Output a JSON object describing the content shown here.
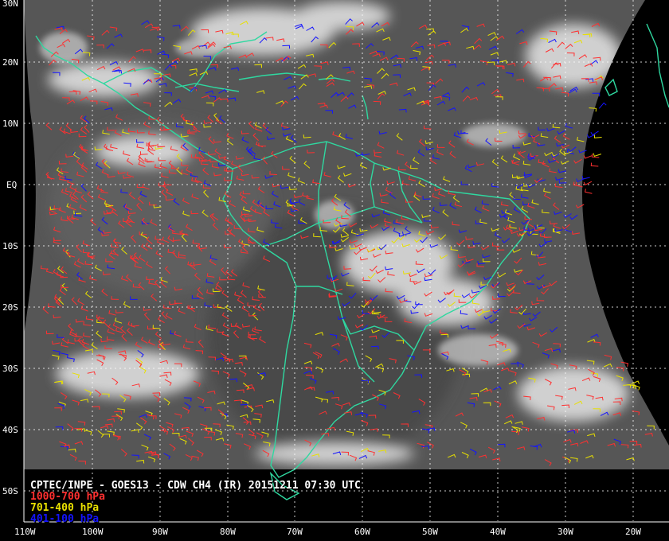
{
  "title": "CPTEC/INPE - GOES13 - CDW CH4 (IR) 20151211 07:30 UTC",
  "legend": [
    {
      "label": "1000-700 hPa",
      "color": "#ff3030"
    },
    {
      "label": "701-400 hPa",
      "color": "#e8e000"
    },
    {
      "label": "401-100 hPa",
      "color": "#1414ff"
    }
  ],
  "lat_labels": [
    "30N",
    "20N",
    "10N",
    "EQ",
    "10S",
    "20S",
    "30S",
    "40S",
    "50S"
  ],
  "lon_labels": [
    "110W",
    "100W",
    "90W",
    "80W",
    "70W",
    "60W",
    "50W",
    "40W",
    "30W",
    "20W"
  ],
  "colors": {
    "coastline": "#2fd8a0",
    "grid": "#ffffff",
    "cloud": "#e8e8e8",
    "background_ir": "#5a5a5a",
    "space": "#000000"
  }
}
